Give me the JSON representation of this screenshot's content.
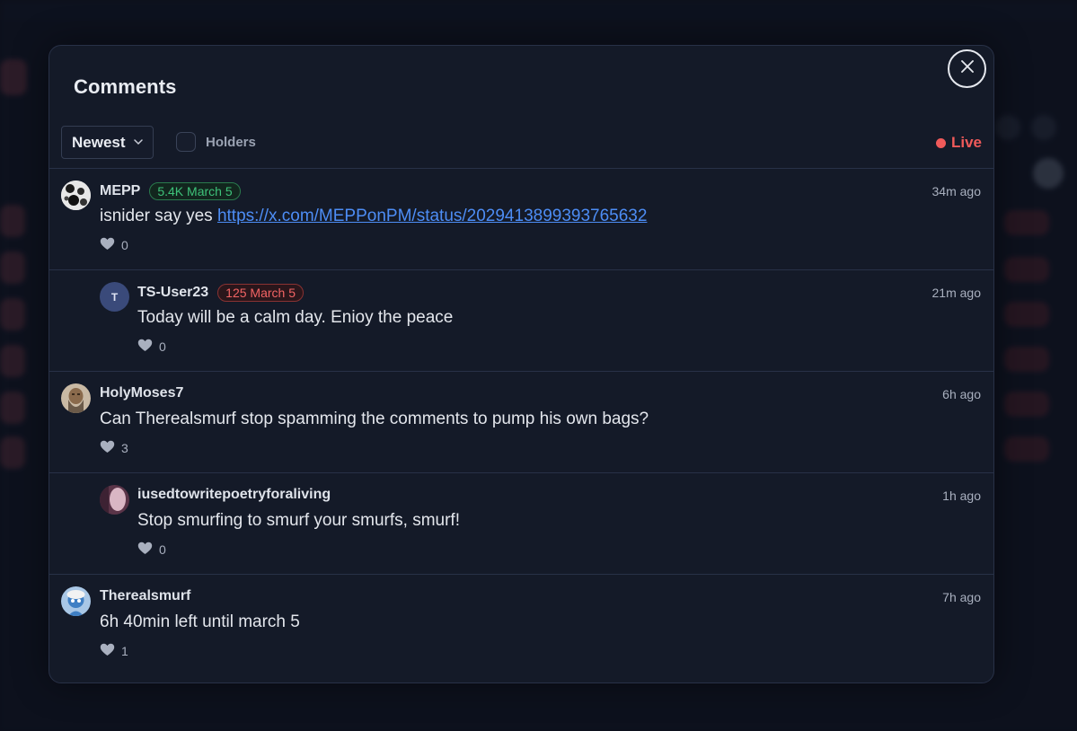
{
  "modal": {
    "title": "Comments"
  },
  "toolbar": {
    "sort_value": "Newest",
    "holders_label": "Holders",
    "live_label": "Live"
  },
  "comments": [
    {
      "username": "MEPP",
      "badge": "5.4K March 5",
      "badge_color": "green",
      "time": "34m ago",
      "text_prefix": "isnider say yes ",
      "link": "https://x.com/MEPPonPM/status/2029413899393765632",
      "likes": "0",
      "reply": false
    },
    {
      "username": "TS-User23",
      "avatar_initial": "T",
      "badge": "125 March 5",
      "badge_color": "red",
      "time": "21m ago",
      "text": "Today will be a calm day. Enioy the peace",
      "likes": "0",
      "reply": true
    },
    {
      "username": "HolyMoses7",
      "time": "6h ago",
      "text": "Can Therealsmurf stop spamming the comments to pump his own bags?",
      "likes": "3",
      "reply": false
    },
    {
      "username": "iusedtowritepoetryforaliving",
      "time": "1h ago",
      "text": "Stop smurfing to smurf your smurfs, smurf!",
      "likes": "0",
      "reply": true
    },
    {
      "username": "Therealsmurf",
      "time": "7h ago",
      "text": "6h 40min left until march 5",
      "likes": "1",
      "reply": false
    }
  ],
  "icons": {
    "close": "close-icon",
    "sort_chevron": "chevron-down-icon",
    "like": "heart-icon",
    "live": "live-dot-icon"
  },
  "colors": {
    "live": "#f05a5a",
    "link": "#4d8df5",
    "badge_green": "#3ec27a",
    "badge_red": "#f36464",
    "modal_bg": "#141a28"
  }
}
